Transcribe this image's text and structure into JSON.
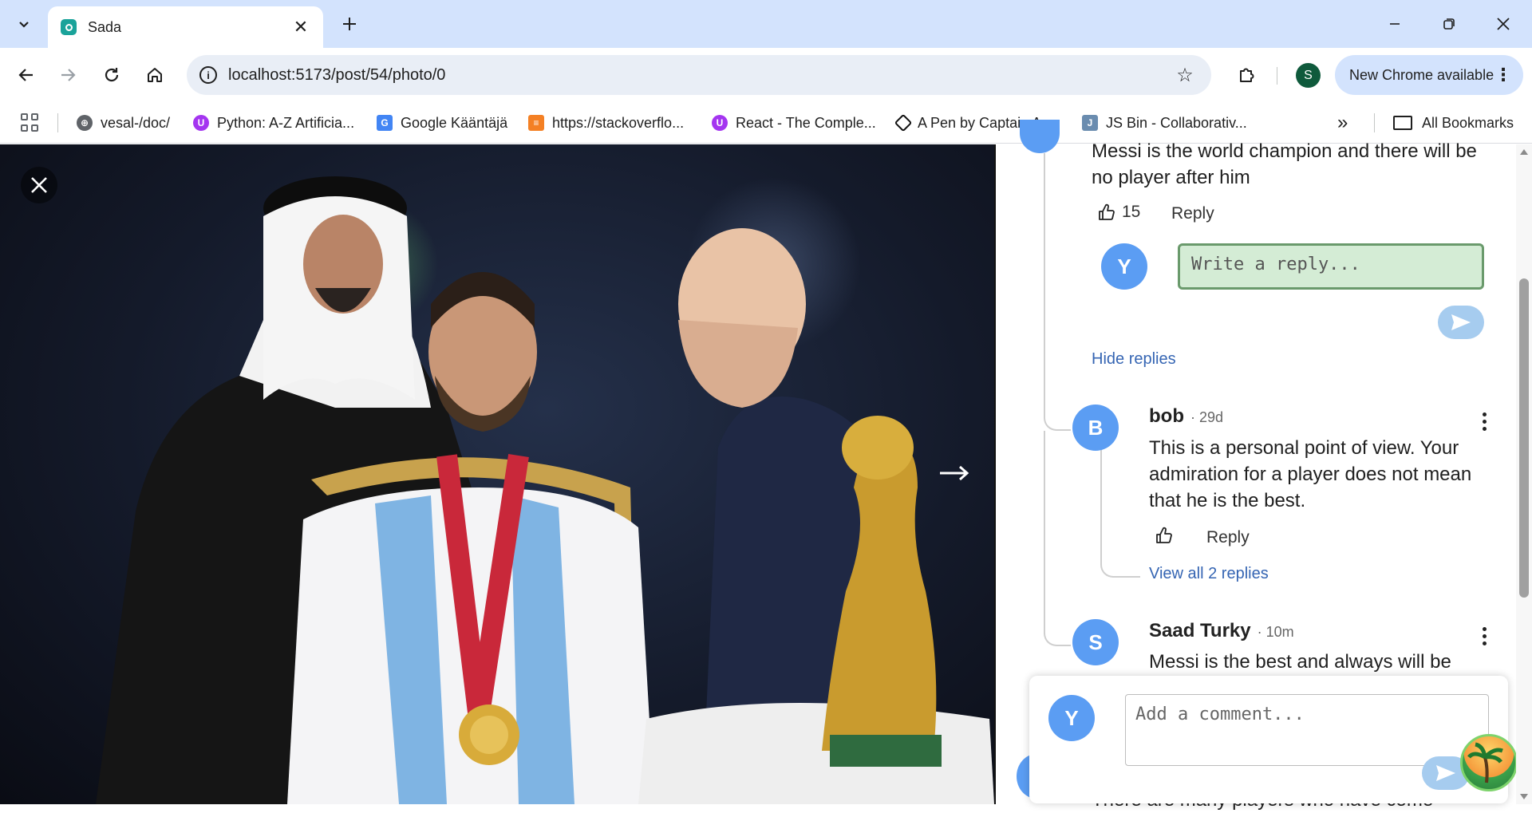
{
  "browser": {
    "tab_title": "Sada",
    "url": "localhost:5173/post/54/photo/0",
    "update_label": "New Chrome available",
    "profile_initial": "S",
    "bookmarks": [
      "vesal-/doc/",
      "Python: A-Z Artificia...",
      "Google Kääntäjä",
      "https://stackoverflo...",
      "React - The Comple...",
      "A Pen by Captain A...",
      "JS Bin - Collaborativ..."
    ],
    "all_bookmarks_label": "All Bookmarks"
  },
  "comments": {
    "first": {
      "text_line1": "Messi is the world champion and there will be",
      "text_line2": "no player after him",
      "likes": "15",
      "reply_label": "Reply"
    },
    "reply_box": {
      "avatar_initial": "Y",
      "placeholder": "Write a reply..."
    },
    "hide_replies_label": "Hide replies",
    "bob": {
      "avatar_initial": "B",
      "name": "bob",
      "time": "· 29d",
      "text_line1": "This is a personal point of view. Your",
      "text_line2": "admiration for a player does not mean",
      "text_line3": "that he is the best.",
      "reply_label": "Reply",
      "view_all_label": "View all 2 replies"
    },
    "saad": {
      "avatar_initial": "S",
      "name": "Saad Turky",
      "time": "· 10m",
      "text_line1": "Messi is the best and always will be"
    },
    "partial_next": "There are many players who have come"
  },
  "composer": {
    "avatar_initial": "Y",
    "placeholder": "Add a comment..."
  },
  "colors": {
    "avatar_blue": "#5b9df3",
    "link_blue": "#3565b3",
    "send_button": "#a6ccef",
    "reply_input_bg": "#d4ecd5"
  }
}
